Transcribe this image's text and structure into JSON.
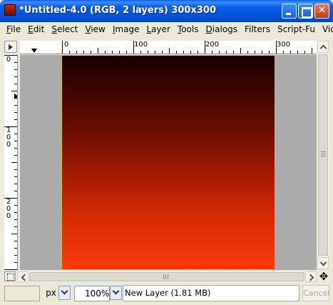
{
  "window": {
    "title": "*Untitled-4.0 (RGB, 2 layers) 300x300",
    "app_icon": "gimp-image-icon",
    "controls": [
      "minimize-icon",
      "maximize-icon",
      "close-icon"
    ],
    "close_glyph": "✕"
  },
  "menubar": {
    "items": [
      {
        "accel": "F",
        "rest": "ile"
      },
      {
        "accel": "E",
        "rest": "dit"
      },
      {
        "accel": "S",
        "rest": "elect"
      },
      {
        "accel": "V",
        "rest": "iew"
      },
      {
        "accel": "I",
        "rest": "mage"
      },
      {
        "accel": "L",
        "rest": "ayer"
      },
      {
        "accel": "T",
        "rest": "ools"
      },
      {
        "accel": "D",
        "rest": "ialogs"
      },
      {
        "accel": "",
        "rest": "Filters"
      },
      {
        "accel": "",
        "rest": "Script-Fu"
      },
      {
        "accel": "",
        "rest": "Video"
      }
    ]
  },
  "rulers": {
    "horizontal_labels": [
      "0",
      "100",
      "200",
      "300"
    ],
    "vertical_labels": [
      [
        "0"
      ],
      [
        "1",
        "0",
        "0"
      ],
      [
        "2",
        "0",
        "0"
      ]
    ]
  },
  "image": {
    "gradient_top": "#170000",
    "gradient_bottom": "#fb3a09",
    "canvas_background": "#ababab"
  },
  "statusbar": {
    "unit": "px",
    "zoom": "100%",
    "layer_info": "New Layer (1.81 MB)",
    "cancel_label": "Cancel",
    "move_glyph": "✥"
  }
}
